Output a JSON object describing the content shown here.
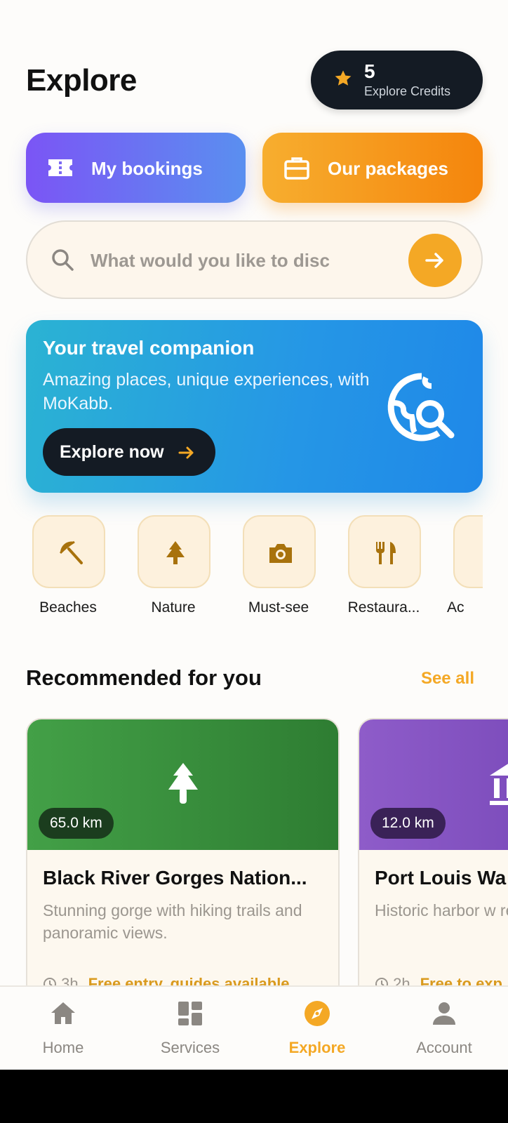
{
  "header": {
    "title": "Explore"
  },
  "credits": {
    "count": "5",
    "label": "Explore Credits",
    "icon": "star-icon"
  },
  "quick_actions": {
    "bookings_label": "My bookings",
    "packages_label": "Our packages"
  },
  "search": {
    "placeholder": "What would you like to discov..."
  },
  "hero": {
    "title": "Your travel companion",
    "subtitle": "Amazing places, unique experiences, with MoKabb.",
    "cta": "Explore now"
  },
  "categories": [
    {
      "label": "Beaches",
      "icon": "umbrella-icon"
    },
    {
      "label": "Nature",
      "icon": "tree-icon"
    },
    {
      "label": "Must-see",
      "icon": "camera-icon"
    },
    {
      "label": "Restaura...",
      "icon": "restaurant-icon"
    },
    {
      "label": "Ac",
      "icon": "activity-icon"
    }
  ],
  "recommended": {
    "title": "Recommended for you",
    "see_all": "See all",
    "items": [
      {
        "distance": "65.0 km",
        "title": "Black River Gorges Nation...",
        "description": "Stunning gorge with hiking trails and panoramic views.",
        "duration": "3h",
        "note": "Free entry, guides available",
        "icon": "tree-icon",
        "color": "#3b9a40"
      },
      {
        "distance": "12.0 km",
        "title": "Port Louis Wa",
        "description": "Historic harbor w restaurants, and",
        "duration": "2h",
        "note": "Free to exp",
        "icon": "museum-icon",
        "color": "#7d4fbf"
      }
    ]
  },
  "bottom_nav": [
    {
      "label": "Home",
      "icon": "home-icon",
      "active": false
    },
    {
      "label": "Services",
      "icon": "grid-icon",
      "active": false
    },
    {
      "label": "Explore",
      "icon": "compass-icon",
      "active": true
    },
    {
      "label": "Account",
      "icon": "person-icon",
      "active": false
    }
  ],
  "colors": {
    "accent": "#f4a825",
    "dark": "#141b24",
    "hero_blue": "#2596e6"
  }
}
